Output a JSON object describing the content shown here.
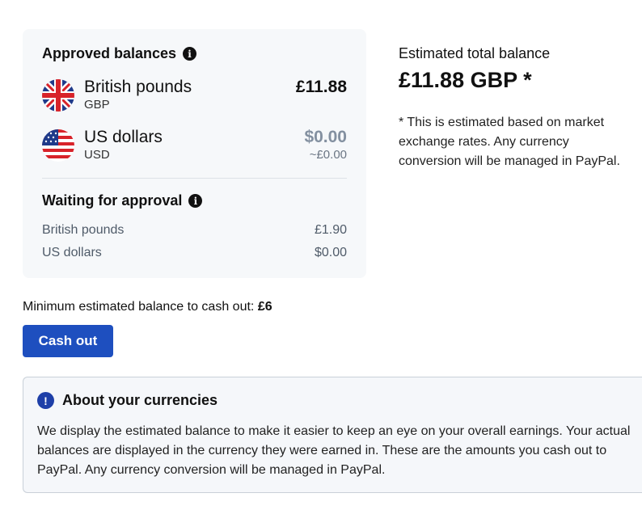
{
  "approved": {
    "title": "Approved balances",
    "info_icon": "i",
    "currencies": [
      {
        "name": "British pounds",
        "code": "GBP",
        "amount": "£11.88",
        "approx": "",
        "flag": "uk-flag-icon"
      },
      {
        "name": "US dollars",
        "code": "USD",
        "amount": "$0.00",
        "approx": "~£0.00",
        "flag": "us-flag-icon"
      }
    ]
  },
  "waiting": {
    "title": "Waiting for approval",
    "info_icon": "i",
    "rows": [
      {
        "name": "British pounds",
        "amount": "£1.90"
      },
      {
        "name": "US dollars",
        "amount": "$0.00"
      }
    ]
  },
  "estimate": {
    "label": "Estimated total balance",
    "value": "£11.88 GBP *",
    "note": "* This is estimated based on market exchange rates. Any currency conversion will be managed in PayPal."
  },
  "cashout": {
    "min_label": "Minimum estimated balance to cash out:",
    "min_value": "£6",
    "button": "Cash out"
  },
  "about": {
    "icon": "!",
    "title": "About your currencies",
    "text": "We display the estimated balance to make it easier to keep an eye on your overall earnings. Your actual balances are displayed in the currency they were earned in. These are the amounts you cash out to PayPal. Any currency conversion will be managed in PayPal."
  },
  "colors": {
    "accent": "#1e4fbf",
    "muted_amount": "#8390a0",
    "card_bg": "#f6f8fa"
  }
}
